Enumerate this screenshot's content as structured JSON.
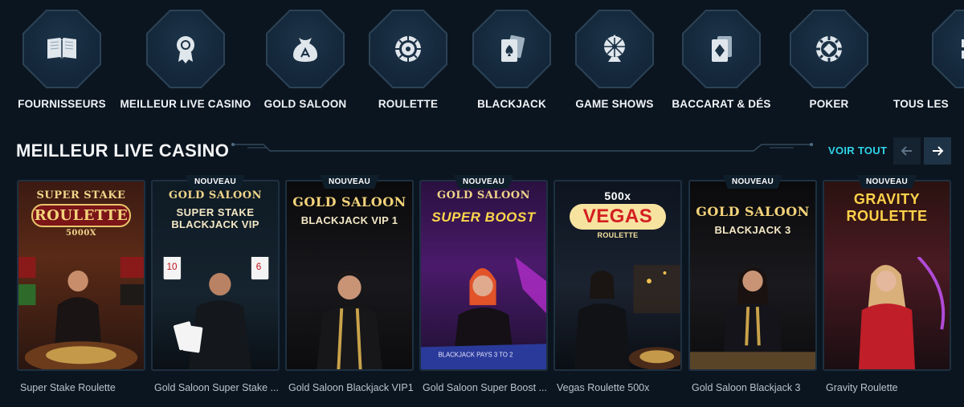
{
  "categories": [
    {
      "label": "FOURNISSEURS",
      "icon": "book-icon"
    },
    {
      "label": "MEILLEUR LIVE CASINO",
      "icon": "award-ribbon-icon"
    },
    {
      "label": "GOLD SALOON",
      "icon": "money-bag-icon"
    },
    {
      "label": "ROULETTE",
      "icon": "roulette-wheel-icon"
    },
    {
      "label": "BLACKJACK",
      "icon": "playing-cards-spade-icon"
    },
    {
      "label": "GAME SHOWS",
      "icon": "wheel-stand-icon"
    },
    {
      "label": "BACCARAT & DÉS",
      "icon": "playing-cards-diamond-icon"
    },
    {
      "label": "POKER",
      "icon": "poker-chip-icon"
    },
    {
      "label": "TOUS LES",
      "icon": "grid-icon"
    }
  ],
  "section": {
    "title": "MEILLEUR LIVE CASINO",
    "view_all": "VOIR TOUT"
  },
  "colors": {
    "background": "#0b1520",
    "accent": "#2fd4e8",
    "octagon": "#13263a"
  },
  "games": [
    {
      "title": "Super Stake Roulette",
      "badge": "",
      "logo_top": "SUPER STAKE",
      "logo_main": "ROULETTE",
      "logo_sub": "5000X"
    },
    {
      "title": "Gold Saloon Super Stake ...",
      "badge": "NOUVEAU",
      "logo_top": "GOLD SALOON",
      "logo_main": "SUPER STAKE",
      "logo_sub": "BLACKJACK VIP"
    },
    {
      "title": "Gold Saloon Blackjack VIP1",
      "badge": "NOUVEAU",
      "logo_top": "",
      "logo_main": "GOLD SALOON",
      "logo_sub": "BLACKJACK VIP 1"
    },
    {
      "title": "Gold Saloon Super Boost ...",
      "badge": "NOUVEAU",
      "logo_top": "GOLD SALOON",
      "logo_main": "SUPER BOOST",
      "logo_sub": ""
    },
    {
      "title": "Vegas Roulette 500x",
      "badge": "",
      "logo_top": "500x",
      "logo_main": "VEGAS",
      "logo_sub": "ROULETTE"
    },
    {
      "title": "Gold Saloon Blackjack 3",
      "badge": "NOUVEAU",
      "logo_top": "",
      "logo_main": "GOLD SALOON",
      "logo_sub": "BLACKJACK 3"
    },
    {
      "title": "Gravity Roulette",
      "badge": "NOUVEAU",
      "logo_top": "GRAVITY",
      "logo_main": "ROULETTE",
      "logo_sub": ""
    }
  ]
}
